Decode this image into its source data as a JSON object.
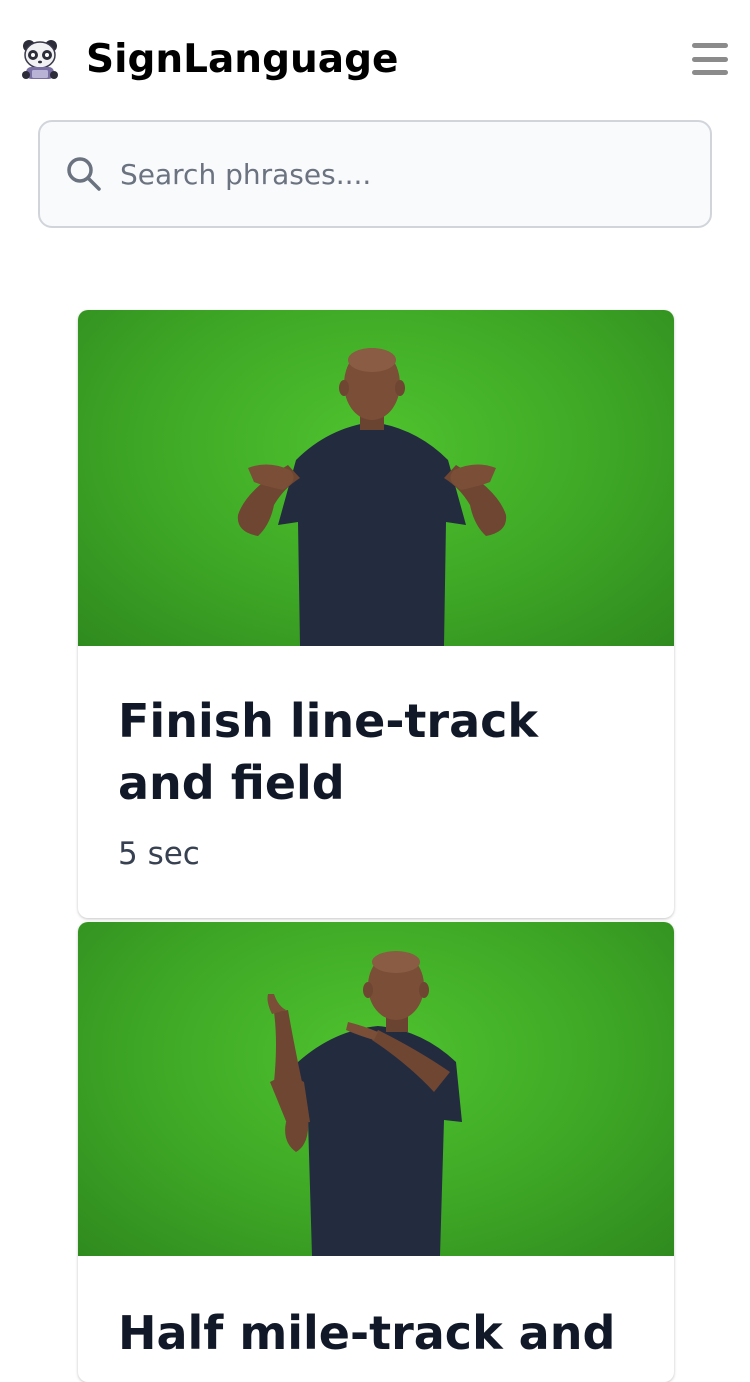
{
  "header": {
    "app_title": "SignLanguage",
    "logo_icon": "panda-logo-icon",
    "menu_icon": "hamburger-menu-icon"
  },
  "search": {
    "placeholder": "Search phrases....",
    "value": "",
    "icon": "search-icon"
  },
  "colors": {
    "thumbnail_background": "#3ea726",
    "title_text": "#111827",
    "muted_text": "#374151",
    "menu_icon": "#8b8b8b"
  },
  "phrases": [
    {
      "title": "Finish line-track and field",
      "duration": "5 sec"
    },
    {
      "title": "Half mile-track and"
    }
  ]
}
